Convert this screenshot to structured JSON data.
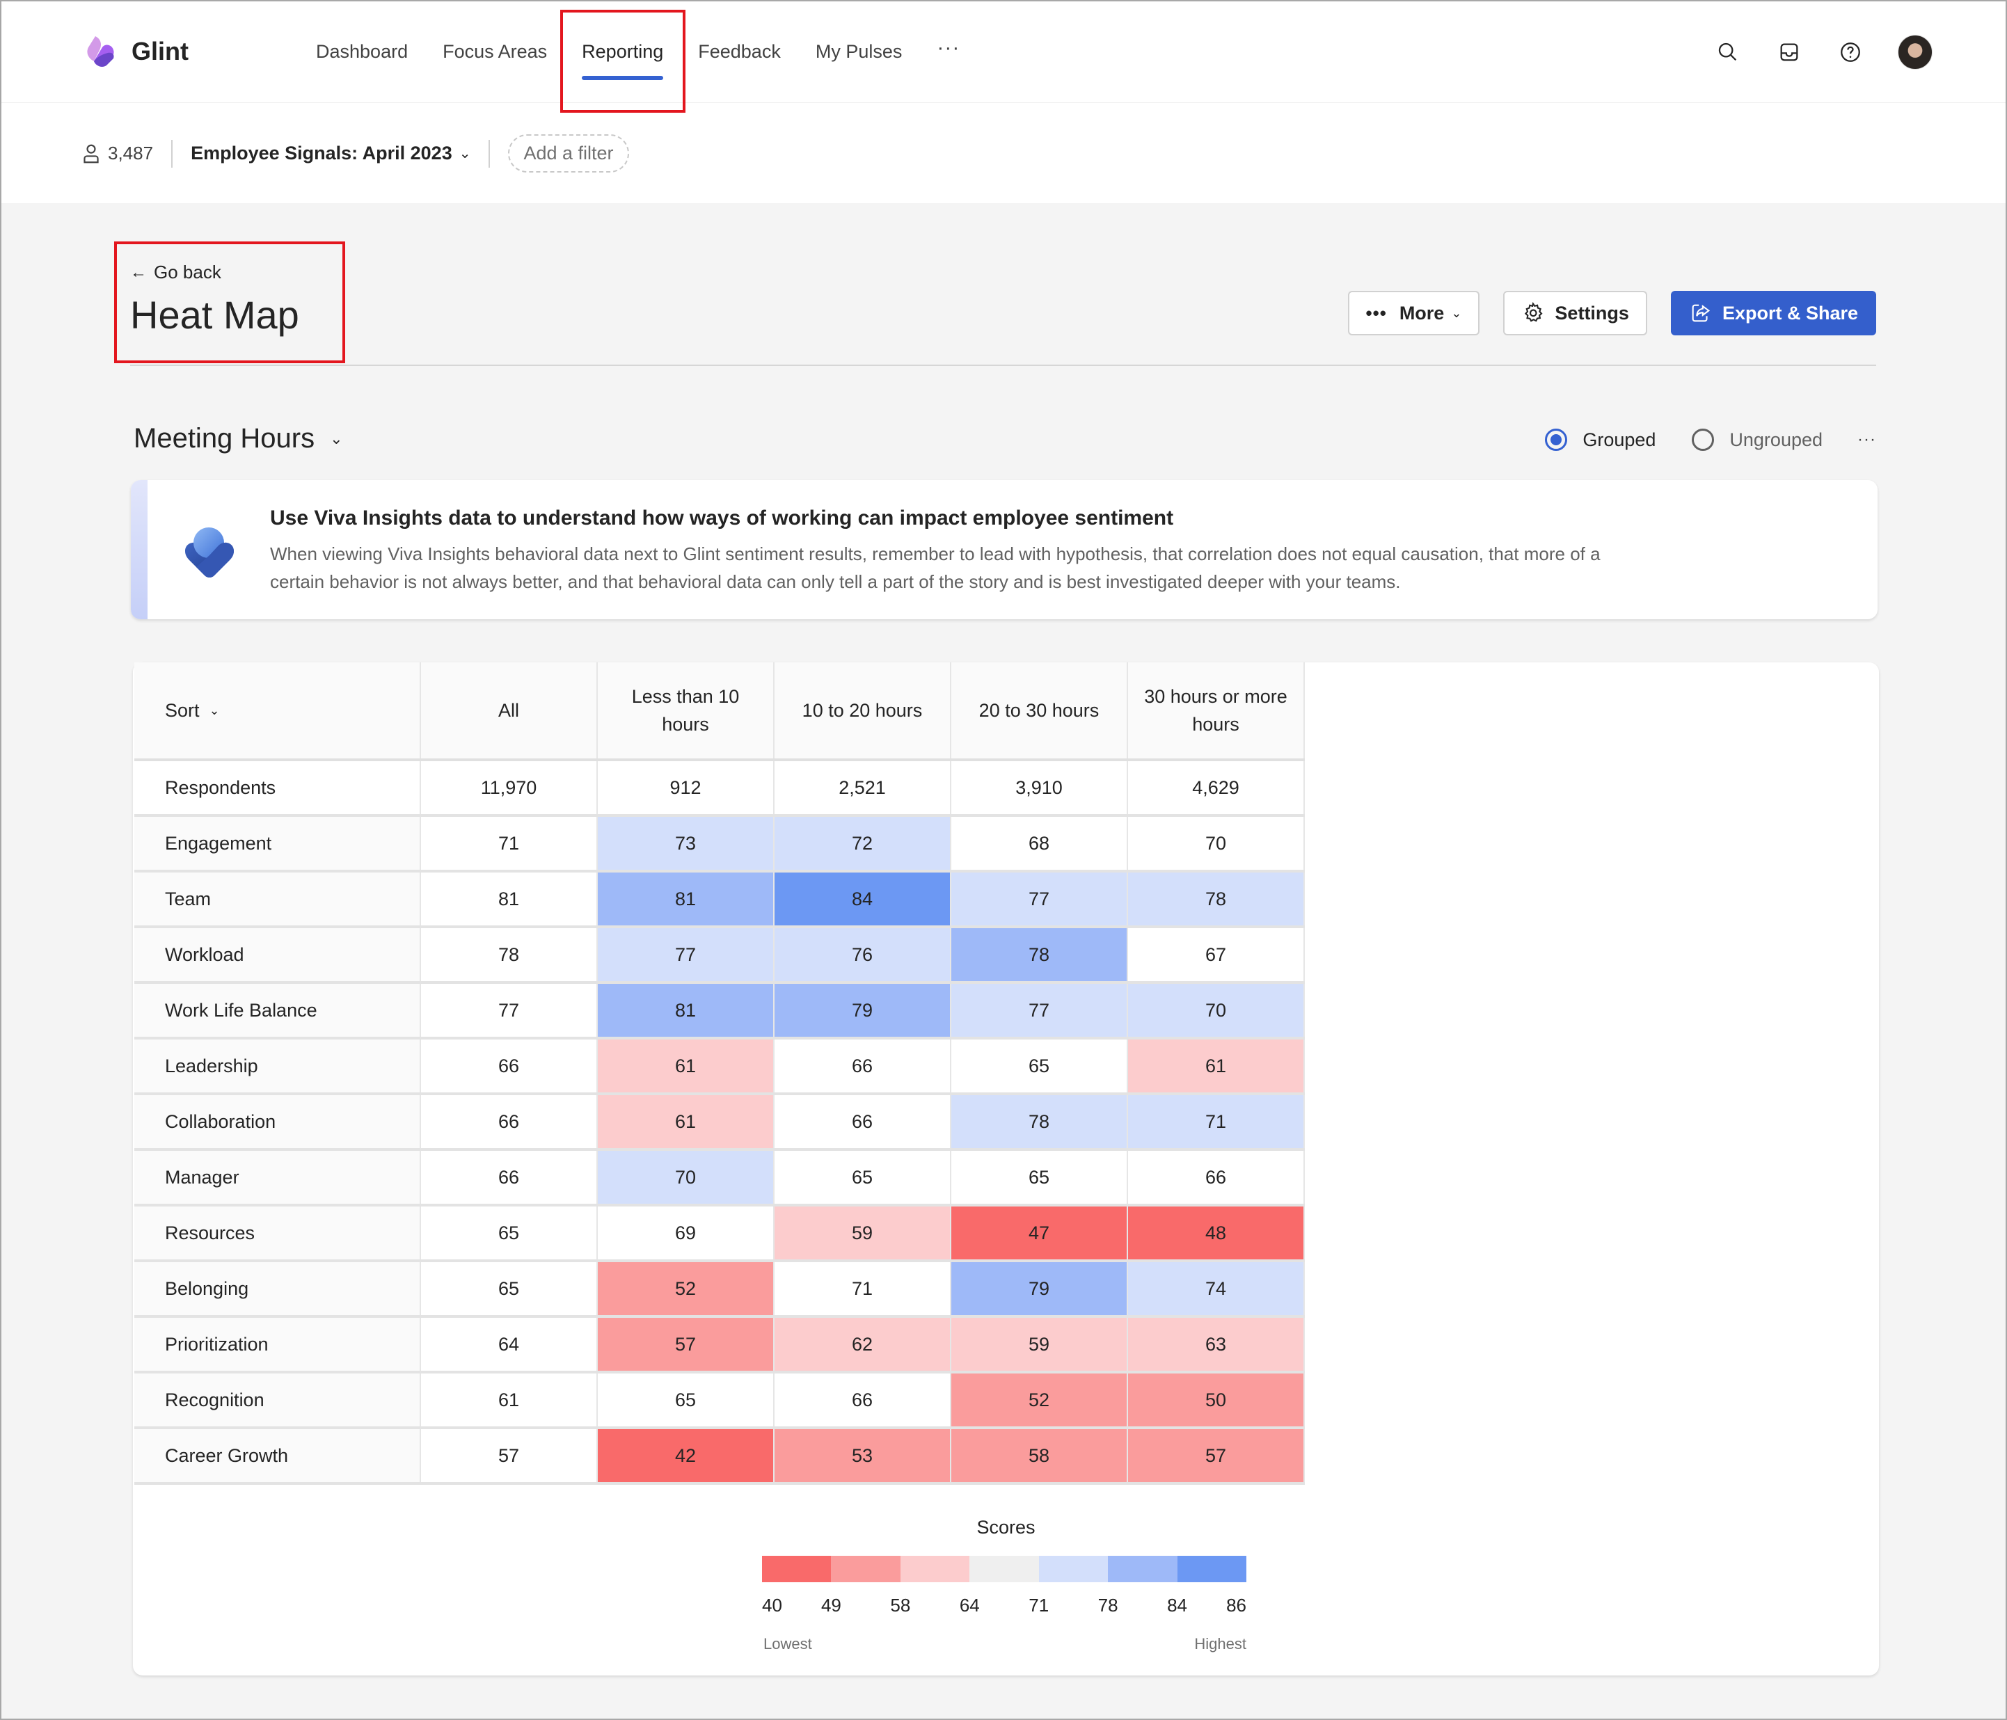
{
  "app": {
    "name": "Glint",
    "nav": [
      {
        "label": "Dashboard",
        "active": false
      },
      {
        "label": "Focus Areas",
        "active": false
      },
      {
        "label": "Reporting",
        "active": true
      },
      {
        "label": "Feedback",
        "active": false
      },
      {
        "label": "My Pulses",
        "active": false
      }
    ],
    "nav_more": "···",
    "top_icons": [
      "search-icon",
      "inbox-icon",
      "help-icon",
      "avatar"
    ]
  },
  "filters": {
    "respondent_count": "3,487",
    "survey": "Employee Signals: April 2023",
    "add_filter": "Add a filter"
  },
  "page": {
    "go_back": "Go back",
    "title": "Heat Map",
    "actions": {
      "more": "More",
      "settings": "Settings",
      "export": "Export & Share"
    }
  },
  "section": {
    "title": "Meeting Hours",
    "view_options": [
      {
        "label": "Grouped",
        "checked": true
      },
      {
        "label": "Ungrouped",
        "checked": false
      }
    ],
    "more": "···"
  },
  "banner": {
    "title": "Use Viva Insights data to understand how ways of working can impact employee sentiment",
    "body": "When viewing Viva Insights behavioral data next to Glint sentiment results, remember to lead with hypothesis, that correlation does not equal causation, that more of a certain behavior is not always better, and that behavioral data can only tell a part of the story and is best investigated deeper with your teams."
  },
  "chart_data": {
    "type": "heatmap",
    "title": "Meeting Hours",
    "sort_label": "Sort",
    "columns": [
      "All",
      "Less than 10 hours",
      "10 to 20 hours",
      "20 to 30 hours",
      "30 hours or more hours"
    ],
    "respondents": {
      "label": "Respondents",
      "values": [
        "11,970",
        "912",
        "2,521",
        "3,910",
        "4,629"
      ]
    },
    "rows": [
      {
        "label": "Engagement",
        "values": [
          71,
          73,
          72,
          68,
          70
        ],
        "levels": [
          null,
          4,
          4,
          3,
          3
        ]
      },
      {
        "label": "Team",
        "values": [
          81,
          81,
          84,
          77,
          78
        ],
        "levels": [
          null,
          5,
          6,
          4,
          4
        ]
      },
      {
        "label": "Workload",
        "values": [
          78,
          77,
          76,
          78,
          67
        ],
        "levels": [
          null,
          4,
          4,
          5,
          3
        ]
      },
      {
        "label": "Work Life Balance",
        "values": [
          77,
          81,
          79,
          77,
          70
        ],
        "levels": [
          null,
          5,
          5,
          4,
          4
        ]
      },
      {
        "label": "Leadership",
        "values": [
          66,
          61,
          66,
          65,
          61
        ],
        "levels": [
          null,
          2,
          3,
          3,
          2
        ]
      },
      {
        "label": "Collaboration",
        "values": [
          66,
          61,
          66,
          78,
          71
        ],
        "levels": [
          null,
          2,
          3,
          4,
          4
        ]
      },
      {
        "label": "Manager",
        "values": [
          66,
          70,
          65,
          65,
          66
        ],
        "levels": [
          null,
          4,
          3,
          3,
          3
        ]
      },
      {
        "label": "Resources",
        "values": [
          65,
          69,
          59,
          47,
          48
        ],
        "levels": [
          null,
          3,
          2,
          0,
          0
        ]
      },
      {
        "label": "Belonging",
        "values": [
          65,
          52,
          71,
          79,
          74
        ],
        "levels": [
          null,
          1,
          3,
          5,
          4
        ]
      },
      {
        "label": "Prioritization",
        "values": [
          64,
          57,
          62,
          59,
          63
        ],
        "levels": [
          null,
          1,
          2,
          2,
          2
        ]
      },
      {
        "label": "Recognition",
        "values": [
          61,
          65,
          66,
          52,
          50
        ],
        "levels": [
          null,
          3,
          3,
          1,
          1
        ]
      },
      {
        "label": "Career Growth",
        "values": [
          57,
          42,
          53,
          58,
          57
        ],
        "levels": [
          null,
          0,
          1,
          1,
          1
        ]
      }
    ],
    "legend": {
      "title": "Scores",
      "colors": [
        "#f96a6a",
        "#fa9c9c",
        "#fccccd",
        "#efefef",
        "#d3dffb",
        "#9eb9f8",
        "#6c98f3"
      ],
      "ticks": [
        "40",
        "49",
        "58",
        "64",
        "71",
        "78",
        "84",
        "86"
      ],
      "low_label": "Lowest",
      "high_label": "Highest"
    }
  }
}
